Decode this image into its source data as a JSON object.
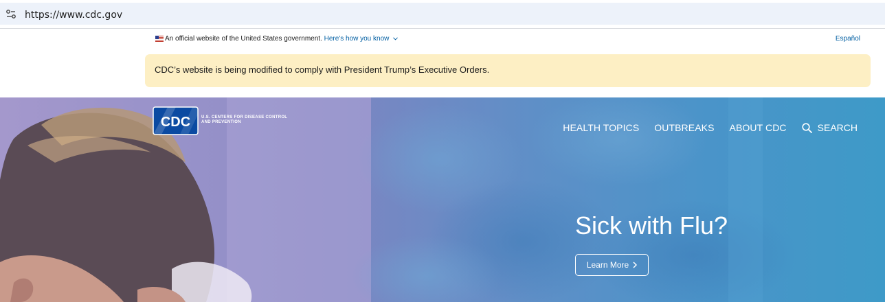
{
  "browser": {
    "url": "https://www.cdc.gov",
    "site_info_icon": "tune-icon"
  },
  "gov_banner": {
    "flag_icon": "us-flag-icon",
    "text": "An official website of the United States government.",
    "link": "Here's how you know",
    "language_link": "Español"
  },
  "alert": {
    "text": "CDC’s website is being modified to comply with President Trump’s Executive Orders."
  },
  "header": {
    "logo_text": "CDC",
    "logo_subtitle": "U.S. CENTERS FOR DISEASE CONTROL AND PREVENTION",
    "nav": [
      {
        "label": "HEALTH TOPICS"
      },
      {
        "label": "OUTBREAKS"
      },
      {
        "label": "ABOUT CDC"
      }
    ],
    "search_label": "SEARCH",
    "search_icon": "search-icon"
  },
  "hero": {
    "title": "Sick with Flu?",
    "button_label": "Learn More",
    "button_icon": "chevron-right-icon"
  },
  "colors": {
    "alert_bg": "#fdefc4",
    "link": "#005ea2",
    "hero_left": "#9b90c6",
    "hero_right": "#3e9ac8",
    "logo_blue": "#0b4aa2"
  }
}
